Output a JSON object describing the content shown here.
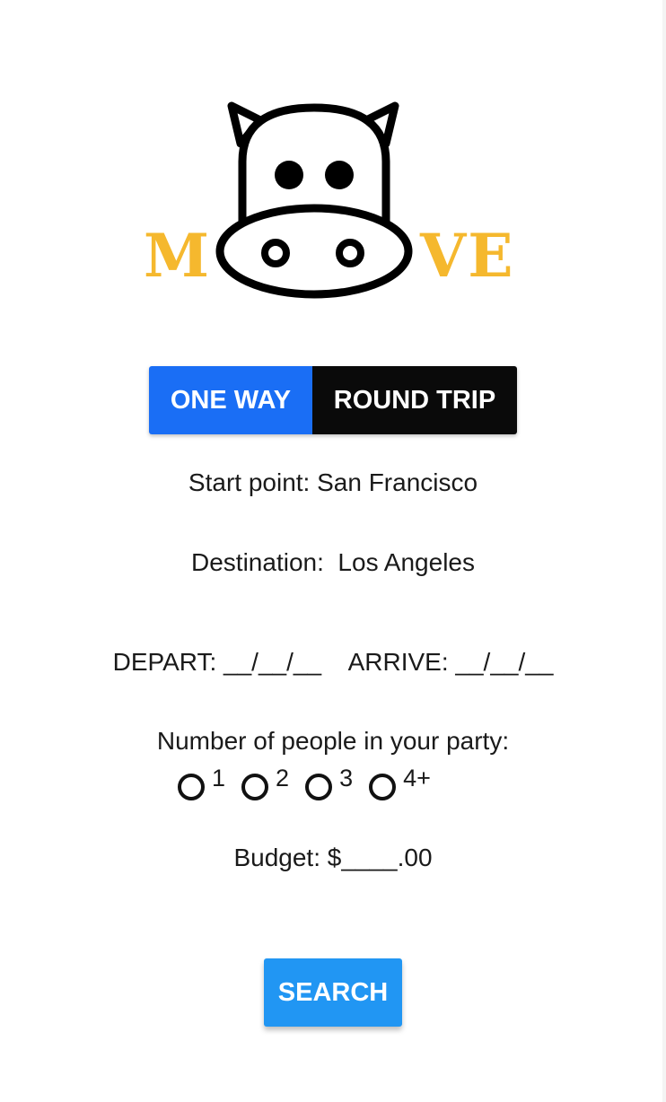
{
  "logo": {
    "left_text": "M",
    "right_text": "VE"
  },
  "trip_toggle": {
    "one_way": "ONE WAY",
    "round_trip": "ROUND TRIP",
    "selected": "ONE WAY"
  },
  "start_point": "Start point: San Francisco",
  "destination": "Destination:  Los Angeles",
  "dates": "DEPART: __/__/__    ARRIVE: __/__/__",
  "party": {
    "label": "Number of people in your party:",
    "options": [
      "1",
      "2",
      "3",
      "4+"
    ]
  },
  "budget": "Budget: $____.00",
  "search_label": "SEARCH",
  "colors": {
    "one_way_bg": "#1a6ef5",
    "round_trip_bg": "#0a0a0a",
    "search_bg": "#2196f3",
    "logo_gold": "#f5b82e",
    "logo_stroke": "#000000"
  }
}
